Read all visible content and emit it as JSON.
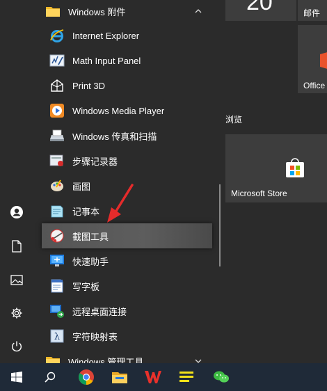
{
  "applist": {
    "items": [
      {
        "label": "Windows 附件",
        "icon": "folder-icon",
        "type": "folder",
        "expanded": true
      },
      {
        "label": "Internet Explorer",
        "icon": "internet-explorer-icon"
      },
      {
        "label": "Math Input Panel",
        "icon": "math-input-panel-icon"
      },
      {
        "label": "Print 3D",
        "icon": "print-3d-icon"
      },
      {
        "label": "Windows Media Player",
        "icon": "media-player-icon"
      },
      {
        "label": "Windows 传真和扫描",
        "icon": "fax-scan-icon"
      },
      {
        "label": "步骤记录器",
        "icon": "steps-recorder-icon"
      },
      {
        "label": "画图",
        "icon": "paint-icon"
      },
      {
        "label": "记事本",
        "icon": "notepad-icon"
      },
      {
        "label": "截图工具",
        "icon": "snipping-tool-icon",
        "highlighted": true
      },
      {
        "label": "快速助手",
        "icon": "quick-assist-icon"
      },
      {
        "label": "写字板",
        "icon": "wordpad-icon"
      },
      {
        "label": "远程桌面连接",
        "icon": "remote-desktop-icon"
      },
      {
        "label": "字符映射表",
        "icon": "character-map-icon"
      },
      {
        "label": "Windows 管理工具",
        "icon": "folder-icon",
        "type": "folder",
        "expanded": false
      }
    ]
  },
  "rail": {
    "icons": [
      "user-icon",
      "document-icon",
      "pictures-icon",
      "settings-icon",
      "power-icon"
    ]
  },
  "tiles": {
    "calendar_fragment": "20",
    "mail_label": "邮件",
    "office_label": "Office",
    "group_browse": "浏览",
    "store_label": "Microsoft Store"
  },
  "taskbar": {
    "icons": [
      "windows-start-icon",
      "search-icon",
      "chrome-icon",
      "file-explorer-icon",
      "wps-icon",
      "notes-icon",
      "wechat-icon"
    ]
  },
  "colors": {
    "background": "#2b2b2b",
    "tile": "#3d3d3d",
    "taskbar": "#1f2a38",
    "highlight": "#5a5a5a",
    "annotation_arrow": "#e52b2b"
  }
}
